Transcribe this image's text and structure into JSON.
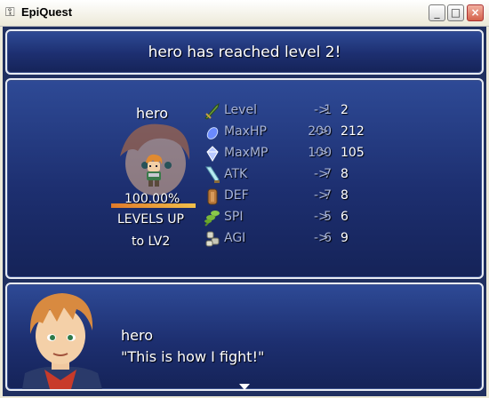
{
  "window": {
    "title": "EpiQuest",
    "icon": "app-icon",
    "buttons": {
      "minimize": "_",
      "maximize": "□",
      "close": "×"
    }
  },
  "message": {
    "text": "hero has reached level 2!"
  },
  "levelup": {
    "hero_name": "hero",
    "exp_percent_text": "100.00%",
    "exp_fill": 1.0,
    "levels_up_text": "LEVELS UP",
    "to_level_text": "to LV2",
    "stats": [
      {
        "label": "Level",
        "old": "1",
        "arrow": "->",
        "new": "2",
        "icon": "sword-icon"
      },
      {
        "label": "MaxHP",
        "old": "200",
        "arrow": "->",
        "new": "212",
        "icon": "hp-crystal-icon"
      },
      {
        "label": "MaxMP",
        "old": "100",
        "arrow": "->",
        "new": "105",
        "icon": "mp-gem-icon"
      },
      {
        "label": "ATK",
        "old": "7",
        "arrow": "->",
        "new": "8",
        "icon": "blade-icon"
      },
      {
        "label": "DEF",
        "old": "7",
        "arrow": "->",
        "new": "8",
        "icon": "shield-icon"
      },
      {
        "label": "SPI",
        "old": "5",
        "arrow": "->",
        "new": "6",
        "icon": "herb-icon"
      },
      {
        "label": "AGI",
        "old": "6",
        "arrow": "->",
        "new": "9",
        "icon": "boots-icon"
      }
    ]
  },
  "dialogue": {
    "speaker": "hero",
    "line": "\"This is how I fight!\""
  },
  "colors": {
    "panel_top": "#2e4a96",
    "panel_bottom": "#152358",
    "label": "#a8b4d8",
    "value": "#ffffff",
    "exp_bar": "#f2c04a"
  }
}
